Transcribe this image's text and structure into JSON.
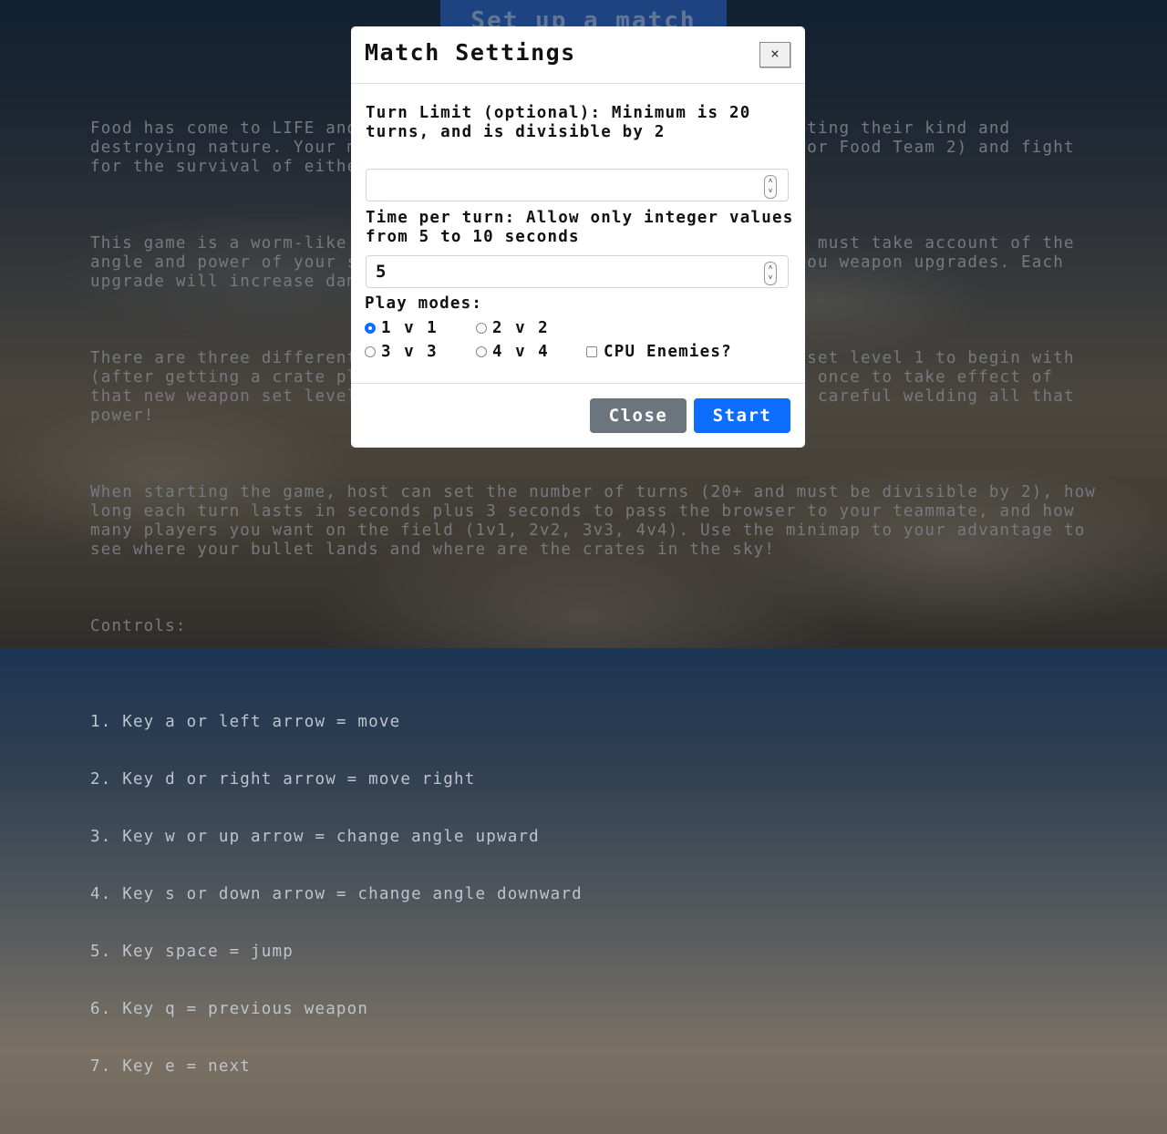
{
  "header_button": "Set up a match",
  "instructions": {
    "paragraphs": [
      "Food has come to LIFE and they are the ones angry about humanity eating their kind and destroying nature. Your mission is to pick a side (Humanity Team 1 or Food Team 2) and fight for the survival of either race!",
      "This game is a worm-like artillery turn-based multiplayer game! You must take account of the angle and power of your shot. Hitting crates in the air will give you weapon upgrades. Each upgrade will increase damage to the weapon you are using.",
      "There are three different weapon sets. Crates will give you weapon set level 1 to begin with (after getting a crate please switch to a different weapon at least once to take effect of that new weapon set level). Try unlocking the next weapon sets with careful welding all that power!",
      "When starting the game, host can set the number of turns (20+ and must be divisible by 2), how long each turn lasts in seconds plus 3 seconds to pass the browser to your teammate, and how many players you want on the field (1v1, 2v2, 3v3, 4v4). Use the minimap to your advantage to see where your bullet lands and where are the crates in the sky!"
    ],
    "controls_title": "Controls:",
    "controls": [
      "1. Key a or left arrow = move",
      "2. Key d or right arrow = move right",
      "3. Key w or up arrow = change angle upward",
      "4. Key s or down arrow = change angle downward",
      "5. Key space = jump",
      "6. Key q = previous weapon",
      "7. Key e = next"
    ]
  },
  "modal": {
    "title": "Match Settings",
    "close_x": "×",
    "turn_limit_label": "Turn Limit (optional): Minimum is 20 turns, and is divisible by 2",
    "turn_limit_value": "",
    "time_label": "Time per turn: Allow only integer values from 5 to 10 seconds",
    "time_value": "5",
    "play_modes_label": "Play modes:",
    "modes": [
      {
        "label": "1 v 1",
        "checked": true
      },
      {
        "label": "2 v 2",
        "checked": false
      },
      {
        "label": "3 v 3",
        "checked": false
      },
      {
        "label": "4 v 4",
        "checked": false
      }
    ],
    "cpu_label": "CPU Enemies?",
    "cpu_checked": false,
    "close_button": "Close",
    "start_button": "Start"
  },
  "colors": {
    "primary": "#0d6efd",
    "secondary": "#6c757d",
    "instruction_text": "#bdc4cc"
  }
}
